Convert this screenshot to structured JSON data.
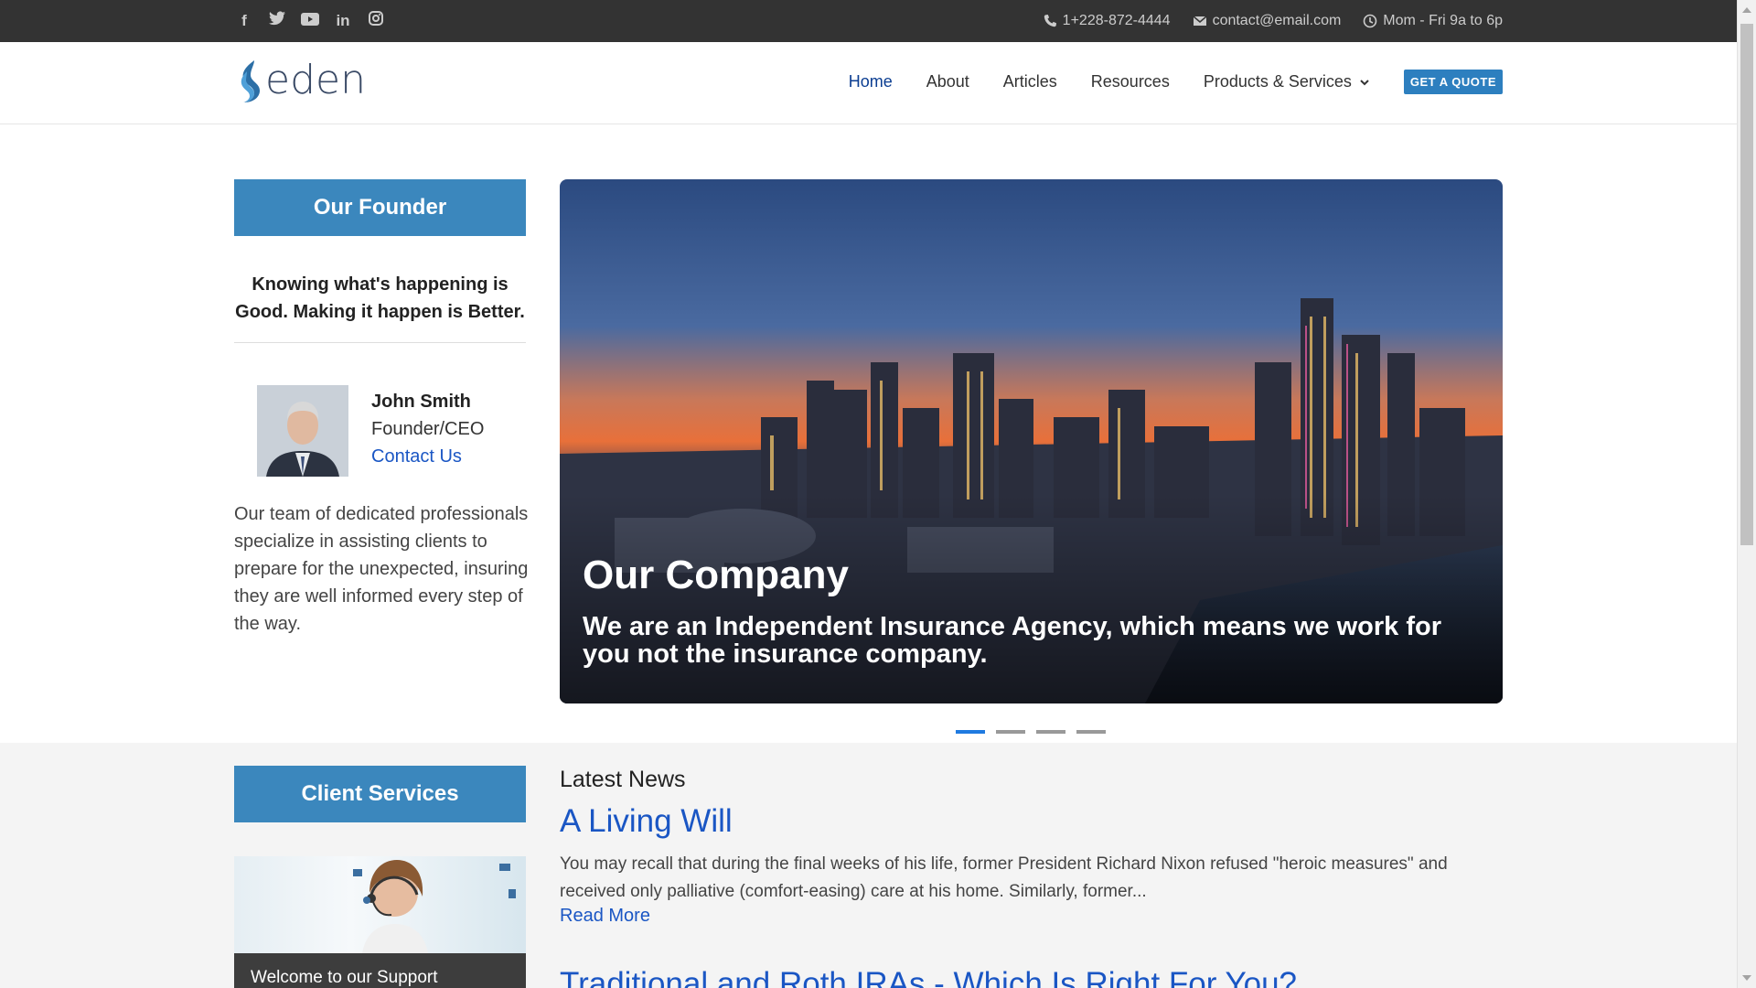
{
  "topbar": {
    "social": [
      {
        "name": "facebook-icon",
        "glyph": "f"
      },
      {
        "name": "twitter-icon",
        "glyph": "🐦"
      },
      {
        "name": "youtube-icon",
        "glyph": "▶"
      },
      {
        "name": "linkedin-icon",
        "glyph": "in"
      },
      {
        "name": "instagram-icon",
        "glyph": "◎"
      }
    ],
    "phone": "1+228-872-4444",
    "email": "contact@email.com",
    "hours": "Mom - Fri 9a to 6p"
  },
  "header": {
    "logo_text": "eden",
    "nav": {
      "home": "Home",
      "about": "About",
      "articles": "Articles",
      "resources": "Resources",
      "products": "Products & Services"
    },
    "quote_button": "GET A QUOTE"
  },
  "founder": {
    "heading": "Our Founder",
    "tagline": "Knowing what's happening is Good. Making it happen is Better.",
    "name": "John Smith",
    "role": "Founder/CEO",
    "contact_link": "Contact Us",
    "description": "Our team of dedicated professionals specialize in assisting clients to prepare for the unexpected, insuring they are well informed every step of the way."
  },
  "hero": {
    "title": "Our Company",
    "subtitle": "We are an Independent Insurance Agency, which means we work for you not the insurance company.",
    "slide_count": 4,
    "active_slide": 1
  },
  "client_services": {
    "heading": "Client Services",
    "support_caption": "Welcome to our Support"
  },
  "news": {
    "heading": "Latest News",
    "articles": [
      {
        "title": "A Living Will",
        "excerpt": "You may recall that during the final weeks of his life, former President Richard Nixon refused \"heroic measures\" and received only palliative (comfort-easing) care at his home. Similarly, former...",
        "read_more": "Read More"
      },
      {
        "title": "Traditional and Roth IRAs - Which Is Right For You?"
      }
    ]
  },
  "colors": {
    "topbar_bg": "#333333",
    "panel_blue": "#3b87bd",
    "link_blue": "#1a56c4",
    "nav_active": "#0b3d91",
    "quote_button": "#2d7fbf",
    "dot_active": "#1f7ae0"
  }
}
